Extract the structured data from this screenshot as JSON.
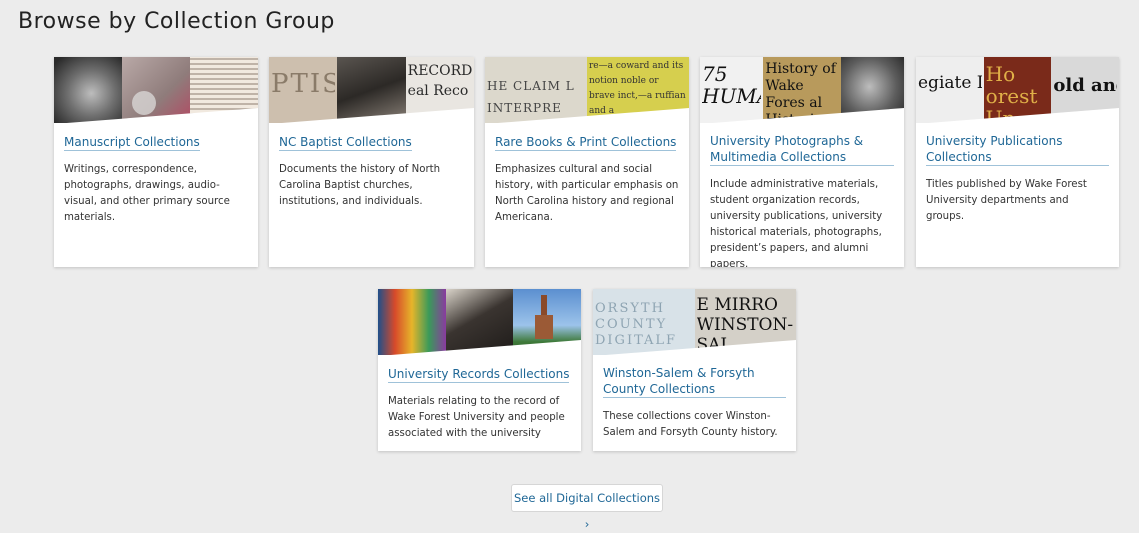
{
  "page": {
    "title": "Browse by Collection Group"
  },
  "cards": [
    {
      "title": "Manuscript Collections",
      "description": "Writings, correspondence, photographs, drawings, audio-visual, and other primary source materials."
    },
    {
      "title": "NC Baptist Collections",
      "description": "Documents the history of North Carolina Baptist churches, institutions, and individuals.",
      "image_text": [
        "PTIS",
        "",
        "RECORDER eal Reco"
      ]
    },
    {
      "title": "Rare Books & Print Collections",
      "description": "Emphasizes cultural and social history, with particular emphasis on North Carolina history and regional Americana.",
      "image_text": [
        "HE CLAIM L INTERPRE",
        "re—a coward and its notion noble or brave inct,—a ruffian and a"
      ]
    },
    {
      "title": "University Photographs & Multimedia Collections",
      "description": "Include administrative materials, student organization records, university publications, university historical materials, photographs, president’s papers, and alumni papers.",
      "image_text": [
        "75 HUMA",
        "History of Wake Fores al Histori"
      ]
    },
    {
      "title": "University Publications Collections",
      "description": "Titles published by Wake Forest University departments and groups.",
      "image_text": [
        "egiate D",
        "Ho orest Un",
        "old and"
      ]
    },
    {
      "title": "University Records Collections",
      "description": "Materials relating to the record of Wake Forest University and people associated with the university"
    },
    {
      "title": "Winston-Salem & Forsyth County Collections",
      "description": "These collections cover Winston-Salem and Forsyth County history.",
      "image_text": [
        "ORSYTH COUNTY DIGITALF",
        "E MIRRO WINSTON-SAL"
      ]
    }
  ],
  "footer": {
    "see_all_label": "See all Digital Collections ›"
  },
  "colors": {
    "link": "#1f6796",
    "background": "#ececec"
  }
}
